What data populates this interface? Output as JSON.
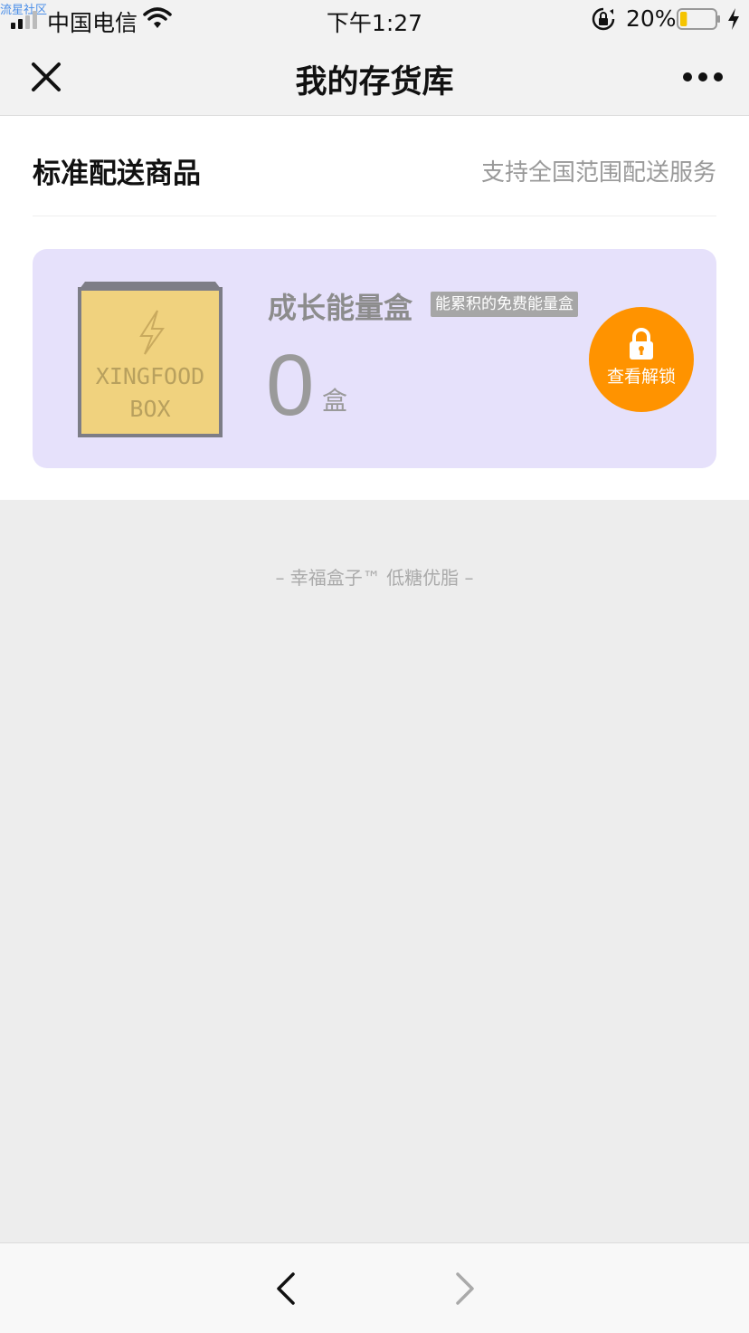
{
  "status_bar": {
    "watermark": "流星社区",
    "carrier": "中国电信",
    "time": "下午1:27",
    "battery_percent": "20%",
    "battery_level": 0.2
  },
  "nav": {
    "title": "我的存货库"
  },
  "section": {
    "title": "标准配送商品",
    "subtitle": "支持全国范围配送服务"
  },
  "product": {
    "name": "成长能量盒",
    "tag": "能累积的免费能量盒",
    "count": "0",
    "unit": "盒",
    "image_text_line1": "XINGFOOD",
    "image_text_line2": "BOX",
    "unlock_label": "查看解锁"
  },
  "footer": {
    "slogan": "– 幸福盒子™ 低糖优脂 –"
  },
  "colors": {
    "accent": "#ff9300",
    "card_bg": "#e6e1fb",
    "box_fill": "#f0d27e"
  }
}
